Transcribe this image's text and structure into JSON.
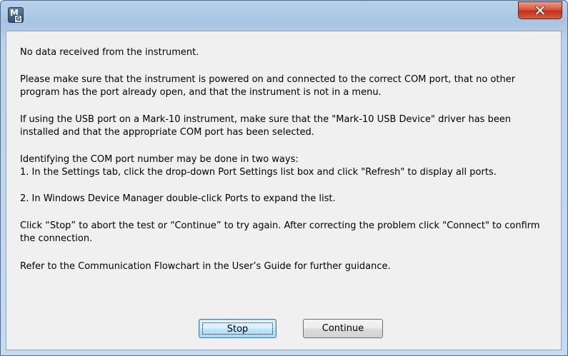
{
  "window": {
    "title": "",
    "app_icon": "mesurgauge-app-icon",
    "app_icon_letters": {
      "main": "M",
      "sub": "G"
    },
    "close_icon": "close-x-icon",
    "accent_colors": {
      "close_button": "#c8402a",
      "frame": "#b9d1ea"
    }
  },
  "message": {
    "line1": "No data received from the instrument.",
    "para2": "Please make sure that the instrument is powered on and connected to the correct COM port, that no other program has the port already open, and that the instrument is not in a menu.",
    "para3": "If using the USB port on a Mark-10 instrument, make sure that the \"Mark-10 USB Device\" driver has been installed and that the appropriate COM port has been selected.",
    "para4_line1": "Identifying the COM port number may be done in two ways:",
    "para4_line2": "1. In the Settings tab, click the drop-down Port Settings list box and click \"Refresh\" to display all ports.",
    "para4_line3": "2. In Windows Device Manager double-click Ports to expand the list.",
    "para5": "Click “Stop” to abort the test or “Continue” to try again. After correcting the problem click \"Connect\" to confirm the connection.",
    "para6": "Refer to the Communication Flowchart in the User’s Guide for further guidance."
  },
  "buttons": {
    "stop_label": "Stop",
    "continue_label": "Continue"
  }
}
